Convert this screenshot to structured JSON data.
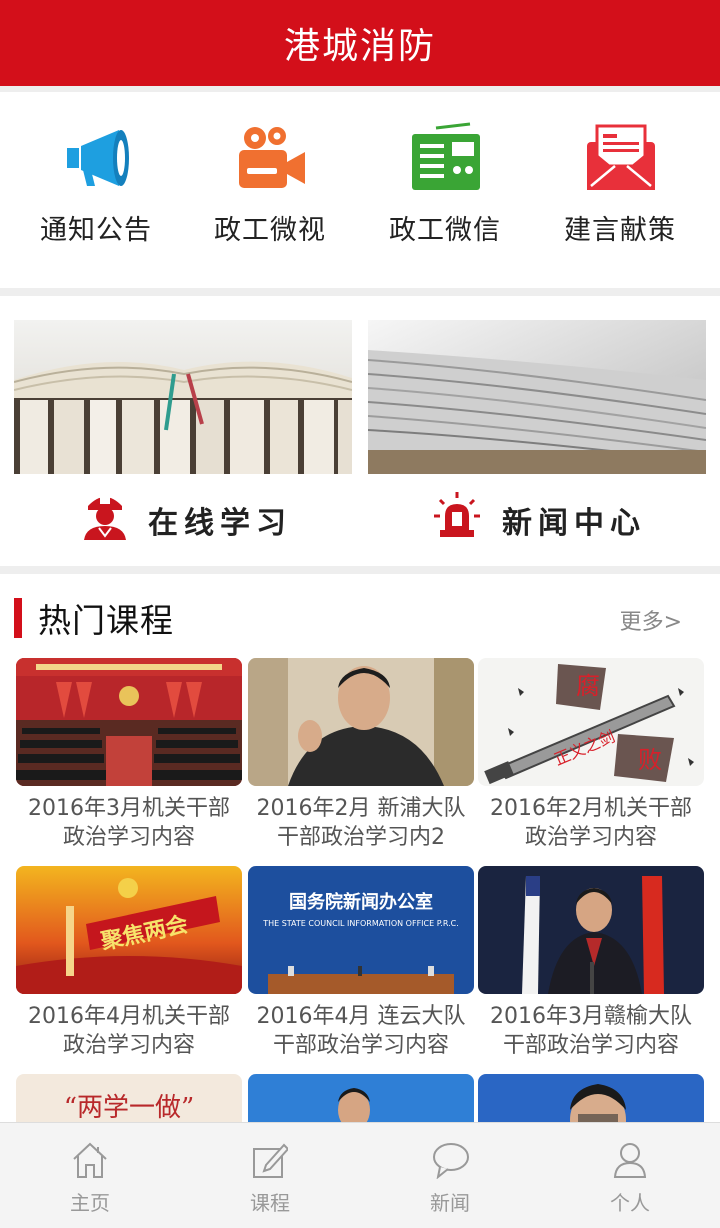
{
  "header": {
    "title": "港城消防"
  },
  "quick_menu": [
    {
      "label": "通知公告",
      "icon": "megaphone-icon"
    },
    {
      "label": "政工微视",
      "icon": "video-camera-icon"
    },
    {
      "label": "政工微信",
      "icon": "radio-icon"
    },
    {
      "label": "建言献策",
      "icon": "envelope-icon"
    }
  ],
  "features": [
    {
      "label": "在线学习",
      "icon": "firefighter-icon",
      "image": "books-photo"
    },
    {
      "label": "新闻中心",
      "icon": "alarm-light-icon",
      "image": "newspaper-photo"
    }
  ],
  "courses": {
    "title": "热门课程",
    "more": "更多>",
    "items": [
      {
        "title": "2016年3月机关干部\n政治学习内容",
        "image": "conference-hall-photo"
      },
      {
        "title": "2016年2月 新浦大队\n干部政治学习内2",
        "image": "leader-portrait-photo"
      },
      {
        "title": "2016年2月机关干部\n政治学习内容",
        "image": "anti-corruption-cartoon"
      },
      {
        "title": "2016年4月机关干部\n政治学习内容",
        "image": "two-sessions-banner"
      },
      {
        "title": "2016年4月 连云大队\n干部政治学习内容",
        "image": "press-office-photo"
      },
      {
        "title": "2016年3月赣榆大队\n干部政治学习内容",
        "image": "leader-speech-photo"
      },
      {
        "title": "",
        "image": "calligraphy-banner"
      },
      {
        "title": "",
        "image": "leader-portrait-photo-2"
      },
      {
        "title": "",
        "image": "leader-portrait-photo-3"
      }
    ]
  },
  "bottom_nav": [
    {
      "label": "主页",
      "icon": "home-icon"
    },
    {
      "label": "课程",
      "icon": "edit-icon"
    },
    {
      "label": "新闻",
      "icon": "chat-bubble-icon"
    },
    {
      "label": "个人",
      "icon": "person-icon"
    }
  ],
  "colors": {
    "brand_red": "#d30f1a",
    "icon_blue": "#1e9fe0",
    "icon_orange": "#f07030",
    "icon_green": "#3aa535",
    "icon_red": "#e8303a",
    "nav_gray": "#999999"
  }
}
